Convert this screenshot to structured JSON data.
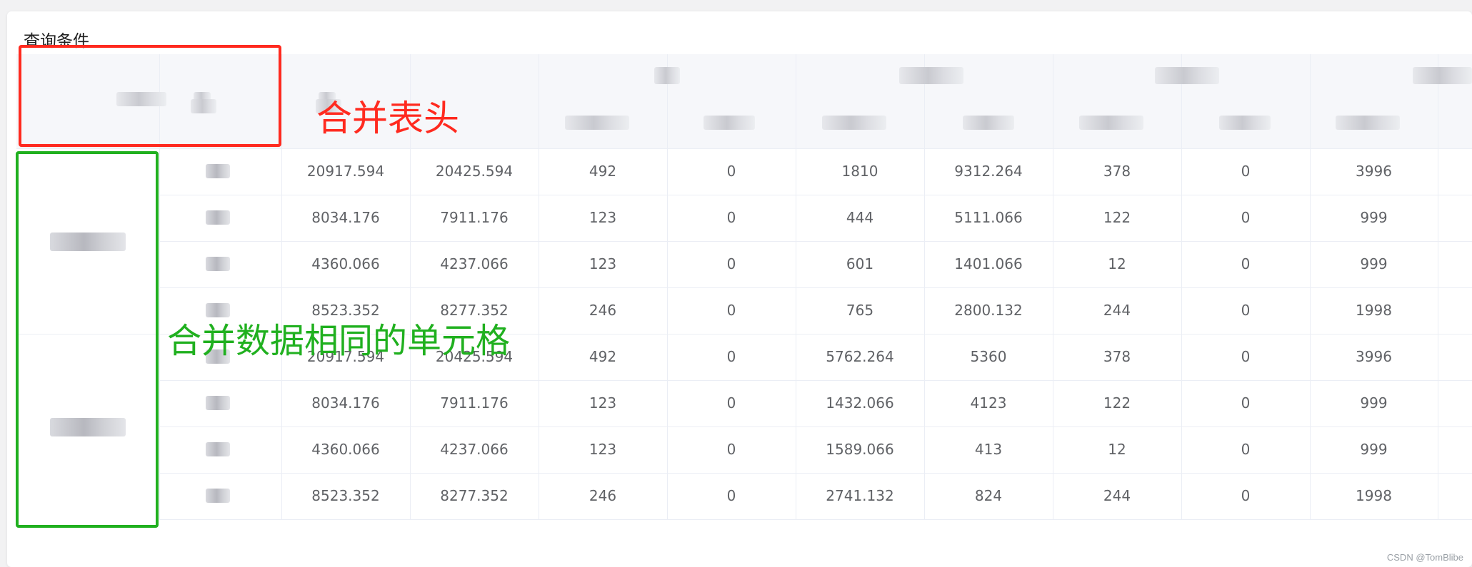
{
  "card": {
    "title": "查询条件"
  },
  "annotations": {
    "merge_header": "合并表头",
    "merge_cells": "合并数据相同的单元格",
    "red": "#ff2a1f",
    "green": "#20b01f"
  },
  "table": {
    "rows": [
      [
        "20917.594",
        "20425.594",
        "492",
        "0",
        "1810",
        "9312.264",
        "378",
        "0",
        "3996"
      ],
      [
        "8034.176",
        "7911.176",
        "123",
        "0",
        "444",
        "5111.066",
        "122",
        "0",
        "999"
      ],
      [
        "4360.066",
        "4237.066",
        "123",
        "0",
        "601",
        "1401.066",
        "12",
        "0",
        "999"
      ],
      [
        "8523.352",
        "8277.352",
        "246",
        "0",
        "765",
        "2800.132",
        "244",
        "0",
        "1998"
      ],
      [
        "20917.594",
        "20425.594",
        "492",
        "0",
        "5762.264",
        "5360",
        "378",
        "0",
        "3996"
      ],
      [
        "8034.176",
        "7911.176",
        "123",
        "0",
        "1432.066",
        "4123",
        "122",
        "0",
        "999"
      ],
      [
        "4360.066",
        "4237.066",
        "123",
        "0",
        "1589.066",
        "413",
        "12",
        "0",
        "999"
      ],
      [
        "8523.352",
        "8277.352",
        "246",
        "0",
        "2741.132",
        "824",
        "244",
        "0",
        "1998"
      ]
    ]
  },
  "watermark": "CSDN @TomBlibe"
}
